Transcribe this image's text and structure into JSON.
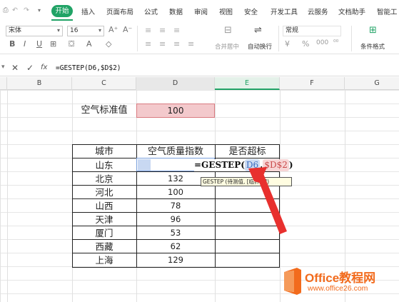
{
  "tabs": {
    "start": "开始",
    "insert": "插入",
    "layout": "页面布局",
    "formula": "公式",
    "data": "数据",
    "review": "审阅",
    "view": "视图",
    "security": "安全",
    "devtools": "开发工具",
    "cloud": "云服务",
    "docs": "文档助手",
    "smart": "智能工"
  },
  "ribbon": {
    "font_name": "宋体",
    "font_size": "16",
    "number_format": "常规",
    "merge_center": "合并居中",
    "wrap_text": "自动换行",
    "cond_format": "条件格式"
  },
  "formula_bar": {
    "content": "=GESTEP(D6,$D$2)"
  },
  "columns": [
    "B",
    "C",
    "D",
    "E",
    "F",
    "G"
  ],
  "sheet": {
    "std_label": "空气标准值",
    "std_value": "100",
    "header": {
      "city": "城市",
      "aqi": "空气质量指数",
      "over": "是否超标"
    },
    "rows": [
      {
        "city": "山东",
        "aqi": ""
      },
      {
        "city": "北京",
        "aqi": "132"
      },
      {
        "city": "河北",
        "aqi": "100"
      },
      {
        "city": "山西",
        "aqi": "78"
      },
      {
        "city": "天津",
        "aqi": "96"
      },
      {
        "city": "厦门",
        "aqi": "53"
      },
      {
        "city": "西藏",
        "aqi": "62"
      },
      {
        "city": "上海",
        "aqi": "129"
      }
    ]
  },
  "edit": {
    "prefix": "=GESTEP(",
    "ref1": "D6",
    "comma": ",",
    "ref2": "$D$2",
    "suffix": ")",
    "tooltip": "GESTEP (待测值, [临界值])"
  },
  "watermark": {
    "brand": "Office教程网",
    "url": "www.office26.com"
  },
  "colors": {
    "accent": "#21a366",
    "ref1": "#5b8fd6",
    "ref2": "#e07070",
    "arrow": "#e8302e",
    "logo": "#f26b1d"
  }
}
